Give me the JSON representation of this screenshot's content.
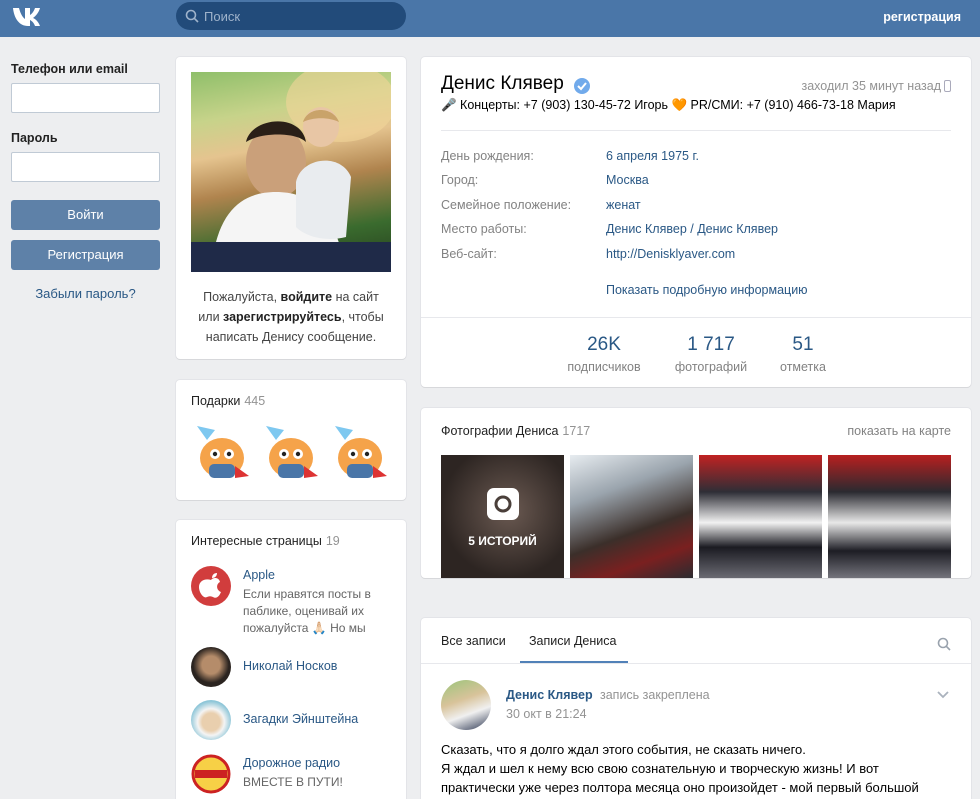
{
  "header": {
    "search_placeholder": "Поиск",
    "register_link": "регистрация",
    "accent": "#4a76a8"
  },
  "login": {
    "phone_label": "Телефон или email",
    "password_label": "Пароль",
    "login_button": "Войти",
    "register_button": "Регистрация",
    "forgot_link": "Забыли пароль?"
  },
  "avatar": {
    "text_before": "Пожалуйста, ",
    "login_word": "войдите",
    "text_mid": " на сайт или ",
    "register_word": "зарегистрируйтесь",
    "text_after": ", чтобы написать Денису сообщение."
  },
  "gifts": {
    "title": "Подарки",
    "count": "445"
  },
  "pages": {
    "title": "Интересные страницы",
    "count": "19",
    "items": [
      {
        "name": "Apple",
        "desc": "Если нравятся посты в паблике, оценивай их пожалуйста 🙏🏻 Но мы"
      },
      {
        "name": "Николай Носков",
        "desc": ""
      },
      {
        "name": "Загадки Эйнштейна",
        "desc": ""
      },
      {
        "name": "Дорожное радио",
        "desc": "ВМЕСТЕ В ПУТИ!"
      }
    ]
  },
  "profile": {
    "name": "Денис Клявер",
    "last_seen": "заходил 35 минут назад",
    "status": "🎤 Концерты: +7 (903) 130-45-72 Игорь 🧡 PR/СМИ: +7 (910) 466-73-18 Мария",
    "info": [
      {
        "label": "День рождения:",
        "value": "6 апреля 1975 г."
      },
      {
        "label": "Город:",
        "value": "Москва"
      },
      {
        "label": "Семейное положение:",
        "value": "женат"
      },
      {
        "label": "Место работы:",
        "value": "Денис Клявер / Денис Клявер"
      },
      {
        "label": "Веб-сайт:",
        "value": "http://Denisklyaver.com"
      }
    ],
    "show_more": "Показать подробную информацию",
    "counters": [
      {
        "num": "26K",
        "label": "подписчиков"
      },
      {
        "num": "1 717",
        "label": "фотографий"
      },
      {
        "num": "51",
        "label": "отметка"
      }
    ]
  },
  "photos": {
    "title": "Фотографии Дениса",
    "count": "1717",
    "map_link": "показать на карте",
    "stories_label": "5 ИСТОРИЙ"
  },
  "wall": {
    "tab_all": "Все записи",
    "tab_own": "Записи Дениса",
    "post": {
      "author": "Денис Клявер",
      "pinned": "запись закреплена",
      "date": "30 окт в 21:24",
      "line1": "Сказать, что я долго ждал этого события, не сказать ничего.",
      "line2": "Я ждал и шел к нему всю свою сознательную и творческую жизнь! И вот",
      "line3": "практически уже через полтора месяца оно произойдет - мой первый большой"
    }
  }
}
